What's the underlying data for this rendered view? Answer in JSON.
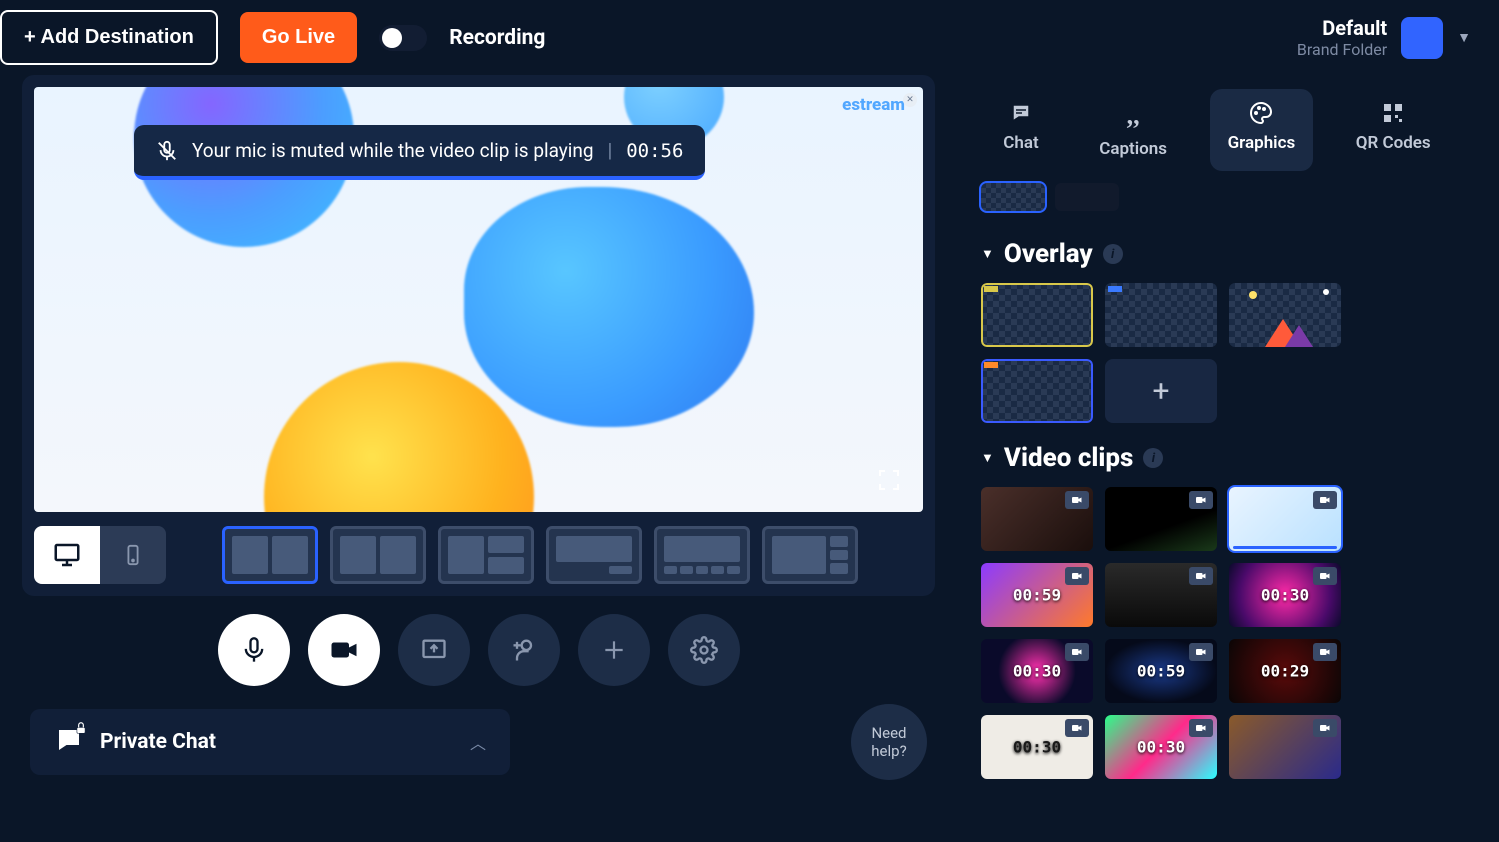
{
  "header": {
    "add_destination": "+ Add Destination",
    "go_live": "Go Live",
    "recording": "Recording",
    "brand_title": "Default",
    "brand_sub": "Brand Folder"
  },
  "stage": {
    "watermark": "estream",
    "mute_msg": "Your mic is muted while the video clip is playing",
    "mute_time": "00:56"
  },
  "controls": {
    "mic": "mic",
    "camera": "camera",
    "present": "present",
    "invite": "invite",
    "add": "add",
    "settings": "settings"
  },
  "chat": {
    "label": "Private Chat"
  },
  "help": {
    "line1": "Need",
    "line2": "help?"
  },
  "tabs": {
    "chat": "Chat",
    "captions": "Captions",
    "graphics": "Graphics",
    "qrcodes": "QR Codes"
  },
  "sections": {
    "overlay": "Overlay",
    "video_clips": "Video clips"
  },
  "clips": [
    {
      "bg": "linear-gradient(135deg,#4a2f2a,#1a0e0c)",
      "time": ""
    },
    {
      "bg": "linear-gradient(160deg,#000 60%,#1a3a1a)",
      "time": ""
    },
    {
      "bg": "linear-gradient(135deg,#e9f4ff,#b9e1ff)",
      "time": "",
      "sel": true
    },
    {
      "bg": "linear-gradient(135deg,#8c3bff,#ff7a2a)",
      "time": "00:59"
    },
    {
      "bg": "linear-gradient(180deg,#2a2a2a,#0a0a0a)",
      "time": ""
    },
    {
      "bg": "radial-gradient(circle,#ff2aa7,#4a0a6a 70%,#0a0a2a)",
      "time": "00:30"
    },
    {
      "bg": "radial-gradient(circle,#d92a9a 10%,#0a0a2a 60%)",
      "time": "00:30"
    },
    {
      "bg": "radial-gradient(ellipse at center,#1a3a8a,#050a1a 70%)",
      "time": "00:59"
    },
    {
      "bg": "radial-gradient(circle,#5a0a0a,#0a0505)",
      "time": "00:29"
    },
    {
      "bg": "#efece6",
      "time": "00:30",
      "dark_text": true
    },
    {
      "bg": "linear-gradient(135deg,#2aff8a,#ff2a8a,#2affff)",
      "time": "00:30"
    },
    {
      "bg": "linear-gradient(135deg,#8a5a2a,#2a2a8a)",
      "time": ""
    }
  ]
}
